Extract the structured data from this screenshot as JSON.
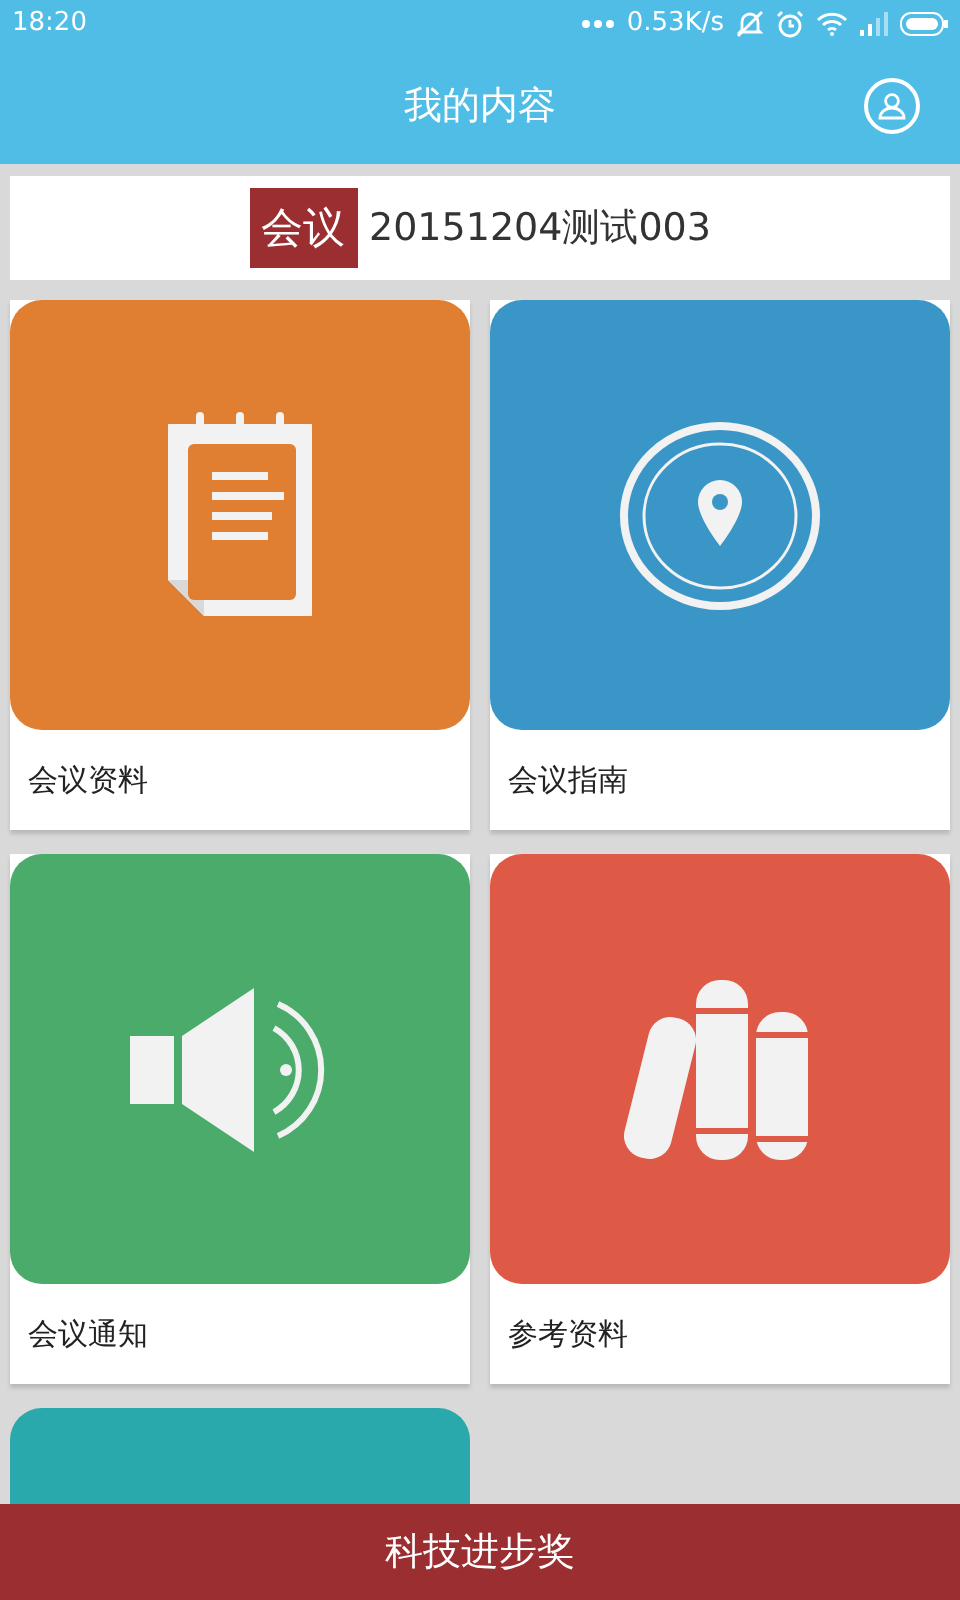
{
  "status_bar": {
    "time": "18:20",
    "speed": "0.53K/s"
  },
  "header": {
    "title": "我的内容"
  },
  "meeting": {
    "tag": "会议",
    "name": "20151204测试003"
  },
  "tiles": [
    {
      "kind": "notepad",
      "label": "会议资料",
      "color": "#e07f32"
    },
    {
      "kind": "compass",
      "label": "会议指南",
      "color": "#3a96c6"
    },
    {
      "kind": "speaker",
      "label": "会议通知",
      "color": "#4aab6a"
    },
    {
      "kind": "books",
      "label": "参考资料",
      "color": "#df5a46"
    },
    {
      "color": "#2aa9ad"
    }
  ],
  "bottom_bar": {
    "label": "科技进步奖"
  }
}
